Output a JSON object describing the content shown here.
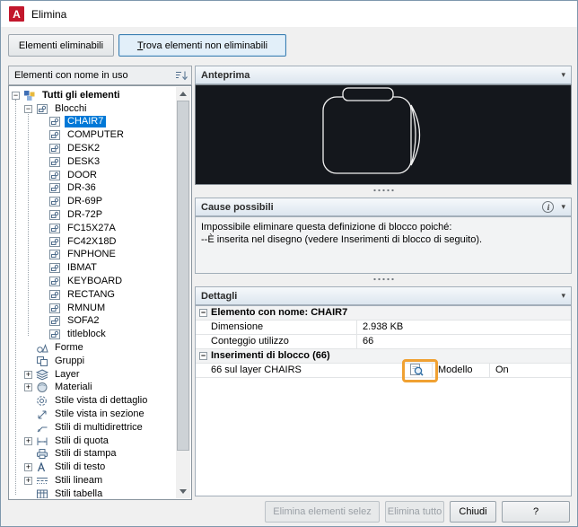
{
  "colors": {
    "selection": "#0078d7",
    "annotation-orange": "#f0a132",
    "preview-bg": "#14171c",
    "accent-border": "#3c7fb1"
  },
  "icons": {
    "chevron_down": "▾",
    "info": "i"
  },
  "window": {
    "title": "Elimina",
    "app_icon": "A"
  },
  "toolbar": {
    "purgeable_button": "Elementi eliminabili",
    "find_button_accel": "T",
    "find_button_rest": "rova elementi non eliminabili"
  },
  "tree": {
    "header": "Elementi con nome in uso",
    "items": [
      {
        "label": "Tutti gli elementi",
        "icon": "all-items",
        "depth": 0,
        "expander": "minus",
        "bold": true
      },
      {
        "label": "Blocchi",
        "icon": "blocks",
        "depth": 1,
        "expander": "minus"
      },
      {
        "label": "CHAIR7",
        "icon": "block",
        "depth": 2,
        "expander": "none",
        "selected": true
      },
      {
        "label": "COMPUTER",
        "icon": "block",
        "depth": 2,
        "expander": "none"
      },
      {
        "label": "DESK2",
        "icon": "block",
        "depth": 2,
        "expander": "none"
      },
      {
        "label": "DESK3",
        "icon": "block",
        "depth": 2,
        "expander": "none"
      },
      {
        "label": "DOOR",
        "icon": "block",
        "depth": 2,
        "expander": "none"
      },
      {
        "label": "DR-36",
        "icon": "block",
        "depth": 2,
        "expander": "none"
      },
      {
        "label": "DR-69P",
        "icon": "block",
        "depth": 2,
        "expander": "none"
      },
      {
        "label": "DR-72P",
        "icon": "block",
        "depth": 2,
        "expander": "none"
      },
      {
        "label": "FC15X27A",
        "icon": "block",
        "depth": 2,
        "expander": "none"
      },
      {
        "label": "FC42X18D",
        "icon": "block",
        "depth": 2,
        "expander": "none"
      },
      {
        "label": "FNPHONE",
        "icon": "block",
        "depth": 2,
        "expander": "none"
      },
      {
        "label": "IBMAT",
        "icon": "block",
        "depth": 2,
        "expander": "none"
      },
      {
        "label": "KEYBOARD",
        "icon": "block",
        "depth": 2,
        "expander": "none"
      },
      {
        "label": "RECTANG",
        "icon": "block",
        "depth": 2,
        "expander": "none"
      },
      {
        "label": "RMNUM",
        "icon": "block",
        "depth": 2,
        "expander": "none"
      },
      {
        "label": "SOFA2",
        "icon": "block",
        "depth": 2,
        "expander": "none"
      },
      {
        "label": "titleblock",
        "icon": "block",
        "depth": 2,
        "expander": "none"
      },
      {
        "label": "Forme",
        "icon": "shapes",
        "depth": 1,
        "expander": "none"
      },
      {
        "label": "Gruppi",
        "icon": "groups",
        "depth": 1,
        "expander": "none"
      },
      {
        "label": "Layer",
        "icon": "layers",
        "depth": 1,
        "expander": "plus"
      },
      {
        "label": "Materiali",
        "icon": "materials",
        "depth": 1,
        "expander": "plus"
      },
      {
        "label": "Stile vista di dettaglio",
        "icon": "detail-view-style",
        "depth": 1,
        "expander": "none"
      },
      {
        "label": "Stile vista in sezione",
        "icon": "section-view-style",
        "depth": 1,
        "expander": "none"
      },
      {
        "label": "Stili di multidirettrice",
        "icon": "mleader-style",
        "depth": 1,
        "expander": "none"
      },
      {
        "label": "Stili di quota",
        "icon": "dim-style",
        "depth": 1,
        "expander": "plus"
      },
      {
        "label": "Stili di stampa",
        "icon": "plot-style",
        "depth": 1,
        "expander": "none"
      },
      {
        "label": "Stili di testo",
        "icon": "text-style",
        "depth": 1,
        "expander": "plus"
      },
      {
        "label": "Stili lineam",
        "icon": "linetype",
        "depth": 1,
        "expander": "plus"
      },
      {
        "label": "Stili tabella",
        "icon": "table-style",
        "depth": 1,
        "expander": "none"
      }
    ]
  },
  "preview": {
    "header": "Anteprima"
  },
  "causes": {
    "header": "Cause possibili",
    "lines": [
      "Impossibile eliminare questa definizione di blocco poiché:",
      "--È inserita nel disegno (vedere Inserimenti di blocco di seguito)."
    ]
  },
  "details": {
    "header": "Dettagli",
    "rows": [
      {
        "type": "group",
        "label": "Elemento con nome: CHAIR7"
      },
      {
        "type": "kv",
        "label": "Dimensione",
        "value": "2.938 KB"
      },
      {
        "type": "kv",
        "label": "Conteggio utilizzo",
        "value": "66"
      },
      {
        "type": "group",
        "label": "Inserimenti di blocco (66)"
      },
      {
        "type": "insert",
        "label": "66 sul layer CHAIRS",
        "space": "Modello",
        "state": "On",
        "icon": "zoom-to-block-insert"
      }
    ]
  },
  "footer": {
    "purge_selected": "Elimina elementi selez",
    "purge_all": "Elimina tutto",
    "close": "Chiudi",
    "help": "?"
  }
}
